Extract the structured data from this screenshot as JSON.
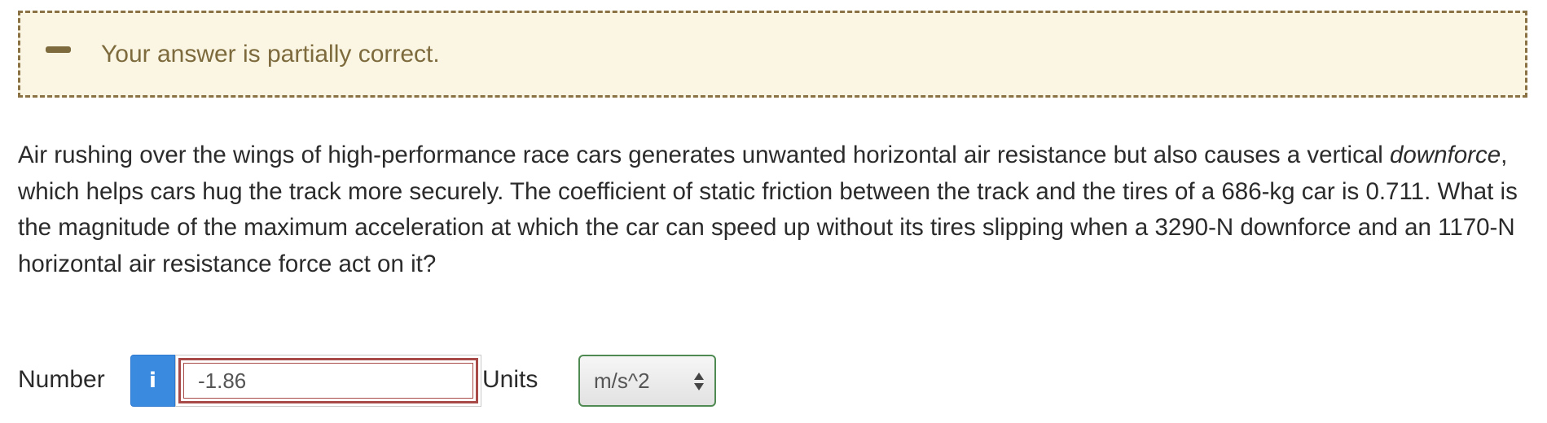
{
  "feedback": {
    "icon": "minus-icon",
    "message": "Your answer is partially correct.",
    "colors": {
      "background": "#faf6e3",
      "border": "#8a7245",
      "text": "#7d6a3d"
    }
  },
  "question": {
    "part1": "Air rushing over the wings of high-performance race cars generates unwanted horizontal air resistance but also causes a vertical ",
    "emphasis": "downforce",
    "part2": ", which helps cars hug the track more securely. The coefficient of static friction between the track and the tires of a 686-kg car is 0.711. What is the magnitude of the maximum acceleration at which the car can speed up without its tires slipping when a 3290-N downforce and an 1170-N horizontal air resistance force act on it?"
  },
  "answer": {
    "number_label": "Number",
    "info_icon": "info-icon",
    "info_glyph": "i",
    "value": "-1.86",
    "units_label": "Units",
    "units_selected": "m/s^2",
    "colors": {
      "info_button": "#3a8be0",
      "input_error_border": "#a84a48",
      "units_border": "#4f8a52"
    }
  }
}
